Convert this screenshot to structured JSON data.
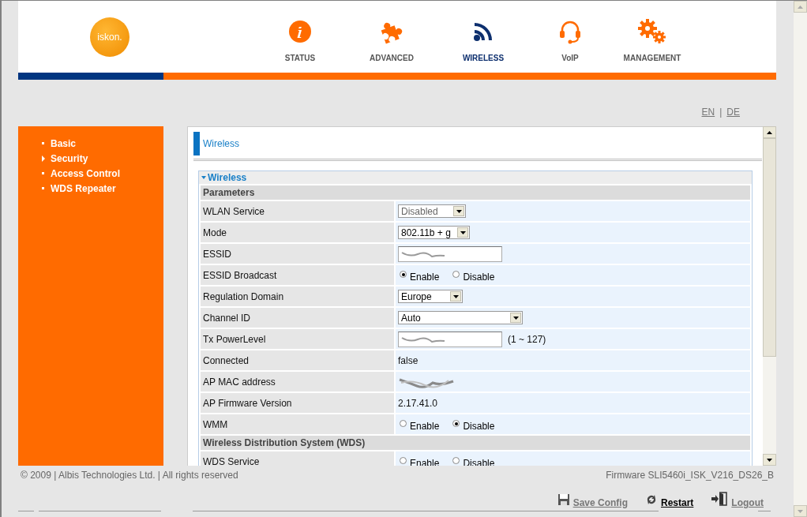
{
  "header": {
    "logo": "iskon.",
    "nav": [
      {
        "label": "STATUS",
        "selected": false
      },
      {
        "label": "ADVANCED",
        "selected": false
      },
      {
        "label": "WIRELESS",
        "selected": true
      },
      {
        "label": "VoIP",
        "selected": false
      },
      {
        "label": "MANAGEMENT",
        "selected": false
      }
    ]
  },
  "languages": {
    "items": [
      "EN",
      "DE"
    ],
    "separator": "|"
  },
  "sidebar": {
    "items": [
      {
        "label": "Basic",
        "selected": false
      },
      {
        "label": "Security",
        "selected": true
      },
      {
        "label": "Access Control",
        "selected": false
      },
      {
        "label": "WDS Repeater",
        "selected": false
      }
    ]
  },
  "page_title": "Wireless",
  "section": {
    "title": "Wireless",
    "expanded": true
  },
  "groups": [
    {
      "heading": "Parameters",
      "rows": [
        {
          "label": "WLAN Service",
          "kind": "select",
          "value": "Disabled",
          "disabled": true
        },
        {
          "label": "Mode",
          "kind": "select",
          "value": "802.11b + g",
          "disabled": false
        },
        {
          "label": "ESSID",
          "kind": "hidden-field"
        },
        {
          "label": "ESSID Broadcast",
          "kind": "radio",
          "options": [
            {
              "label": "Enable",
              "selected": true
            },
            {
              "label": "Disable",
              "selected": false
            }
          ]
        },
        {
          "label": "Regulation Domain",
          "kind": "select",
          "value": "Europe",
          "disabled": false
        },
        {
          "label": "Channel ID",
          "kind": "select",
          "value": "Auto",
          "disabled": false
        },
        {
          "label": "Tx PowerLevel",
          "kind": "hidden-field",
          "hint": "(1 ~ 127)"
        },
        {
          "label": "Connected",
          "kind": "text",
          "value": "false"
        },
        {
          "label": "AP MAC address",
          "kind": "hidden-text"
        },
        {
          "label": "AP Firmware Version",
          "kind": "text",
          "value": "2.17.41.0"
        },
        {
          "label": "WMM",
          "kind": "radio",
          "options": [
            {
              "label": "Enable",
              "selected": false
            },
            {
              "label": "Disable",
              "selected": true
            }
          ]
        }
      ]
    },
    {
      "heading": "Wireless Distribution System (WDS)",
      "rows": [
        {
          "label": "WDS Service",
          "kind": "radio",
          "options": [
            {
              "label": "Enable",
              "selected": false
            },
            {
              "label": "Disable",
              "selected": false
            }
          ]
        }
      ]
    }
  ],
  "footer": {
    "copyright": "© 2009 | Albis Technologies Ltd. | All rights reserved",
    "firmware": "Firmware SLI5460i_ISK_V216_DS26_B",
    "actions": [
      {
        "label": "Save Config",
        "selected": false
      },
      {
        "label": "Restart",
        "selected": true
      },
      {
        "label": "Logout",
        "selected": false
      }
    ]
  }
}
